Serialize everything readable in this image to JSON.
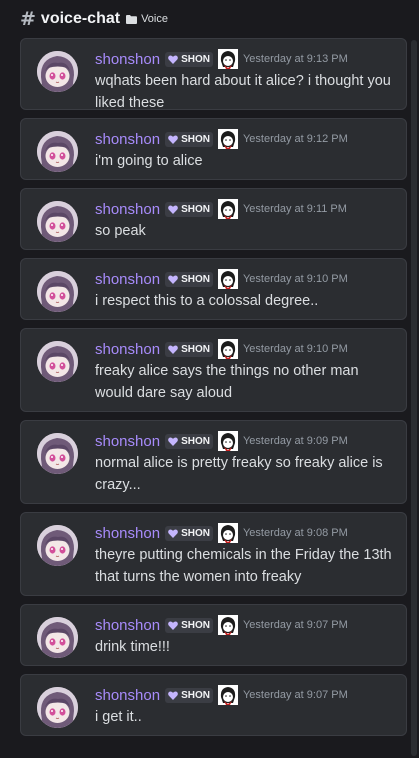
{
  "header": {
    "hash": "#",
    "channel": "voice-chat",
    "category": "Voice"
  },
  "colors": {
    "background": "#1a1a1e",
    "card": "#2b2d31",
    "username": "#a78bfa",
    "timestamp": "#949ba4",
    "tag_bg": "#3b3d44",
    "tag_heart": "#c4b5fd"
  },
  "messages": [
    {
      "username": "shonshon",
      "tag": "SHON",
      "timestamp": "Yesterday at 9:13 PM",
      "text": "wqhats been hard about it alice? i thought you liked these"
    },
    {
      "username": "shonshon",
      "tag": "SHON",
      "timestamp": "Yesterday at 9:12 PM",
      "text": "i'm going to alice"
    },
    {
      "username": "shonshon",
      "tag": "SHON",
      "timestamp": "Yesterday at 9:11 PM",
      "text": "so peak"
    },
    {
      "username": "shonshon",
      "tag": "SHON",
      "timestamp": "Yesterday at 9:10 PM",
      "text": "i respect this to a colossal degree.."
    },
    {
      "username": "shonshon",
      "tag": "SHON",
      "timestamp": "Yesterday at 9:10 PM",
      "text": "freaky alice says the things no other man would dare say aloud"
    },
    {
      "username": "shonshon",
      "tag": "SHON",
      "timestamp": "Yesterday at 9:09 PM",
      "text": "normal alice is pretty freaky so freaky alice is crazy..."
    },
    {
      "username": "shonshon",
      "tag": "SHON",
      "timestamp": "Yesterday at 9:08 PM",
      "text": "theyre putting chemicals in the Friday the 13th that turns the women into freaky"
    },
    {
      "username": "shonshon",
      "tag": "SHON",
      "timestamp": "Yesterday at 9:07 PM",
      "text": "drink time!!!"
    },
    {
      "username": "shonshon",
      "tag": "SHON",
      "timestamp": "Yesterday at 9:07 PM",
      "text": "i get it.."
    }
  ]
}
